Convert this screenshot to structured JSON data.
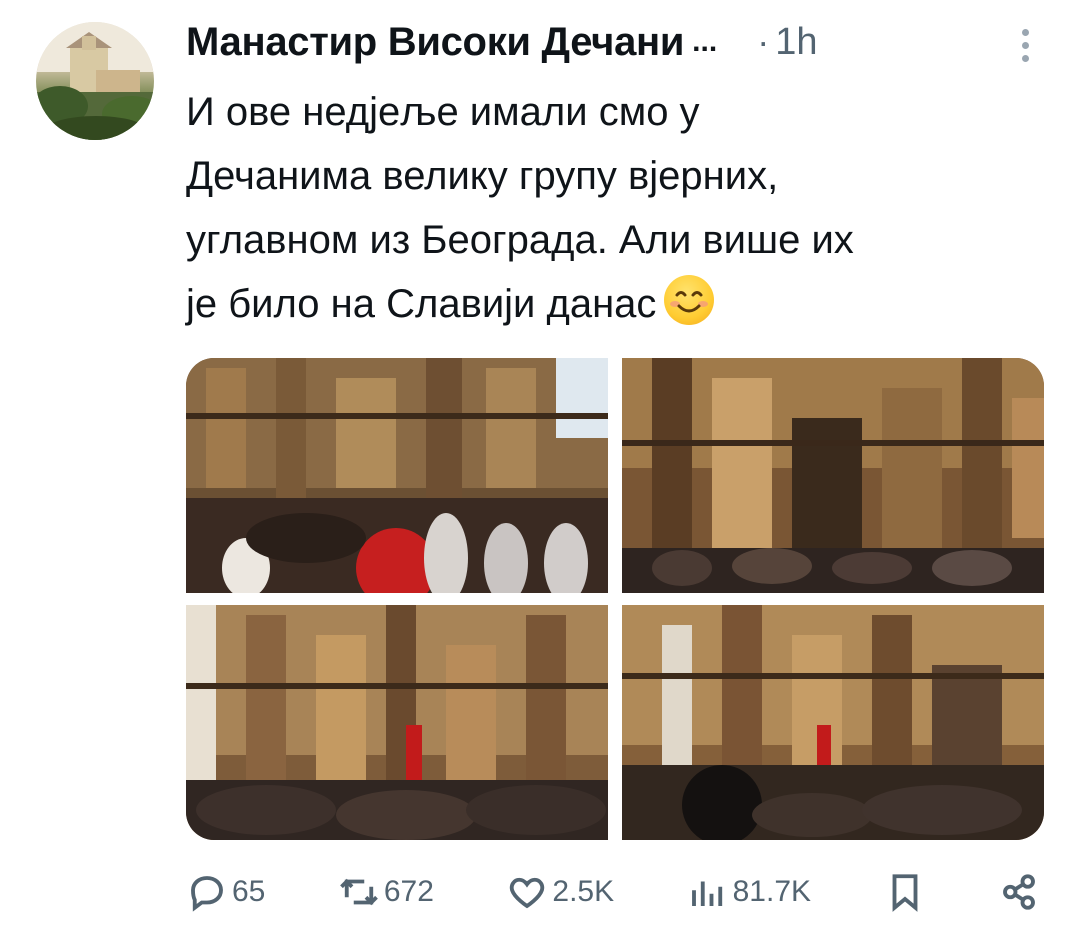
{
  "tweet": {
    "author_name": "Манастир Високи Дечани",
    "name_ellipsis": "...",
    "separator": "·",
    "time": "1h",
    "text": "И ове недјеље имали смо у\nДечанима велику групу вјерних,\nуглавном из Београда. Али више их\nје било на Славији данас",
    "emoji": "smiling-face-icon",
    "photos": [
      {
        "subject": "church-interior-liturgy-photo"
      },
      {
        "subject": "church-interior-congregation-photo"
      },
      {
        "subject": "church-interior-nave-photo"
      },
      {
        "subject": "church-interior-crowd-photo"
      }
    ]
  },
  "actions": {
    "replies": "65",
    "reposts": "672",
    "likes": "2.5K",
    "views": "81.7K"
  },
  "icons": {
    "reply": "speech-bubble-icon",
    "repost": "retweet-icon",
    "like": "heart-icon",
    "views": "bar-chart-icon",
    "bookmark": "bookmark-icon",
    "share": "share-icon",
    "more": "more-vertical-icon"
  },
  "colors": {
    "text": "#0f1419",
    "secondary": "#536471"
  }
}
